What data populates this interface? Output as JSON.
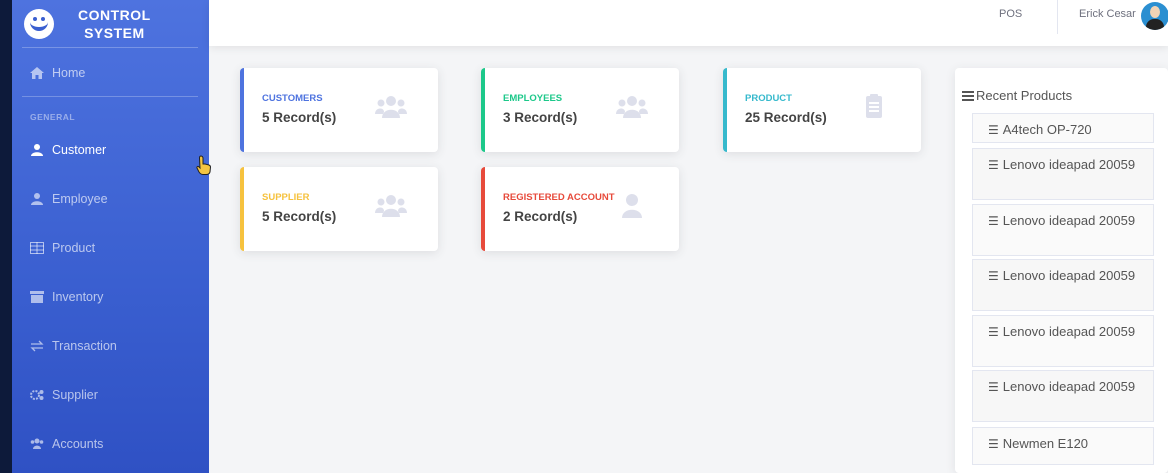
{
  "brand": {
    "line1": "CONTROL",
    "line2": "SYSTEM",
    "logo_icon": "smiley-logo-icon"
  },
  "sidebar": {
    "home": "Home",
    "heading": "GENERAL",
    "items": [
      {
        "label": "Customer",
        "icon": "user-icon",
        "active": true
      },
      {
        "label": "Employee",
        "icon": "user-icon",
        "active": false
      },
      {
        "label": "Product",
        "icon": "table-icon",
        "active": false
      },
      {
        "label": "Inventory",
        "icon": "archive-icon",
        "active": false
      },
      {
        "label": "Transaction",
        "icon": "exchange-icon",
        "active": false
      },
      {
        "label": "Supplier",
        "icon": "cogs-icon",
        "active": false
      },
      {
        "label": "Accounts",
        "icon": "users-icon",
        "active": false
      }
    ]
  },
  "topbar": {
    "pos": "POS",
    "user_name": "Erick Cesar"
  },
  "cards": [
    {
      "label": "CUSTOMERS",
      "value": "5 Record(s)",
      "color": "#4e73df",
      "icon": "users-group-icon"
    },
    {
      "label": "EMPLOYEES",
      "value": "3 Record(s)",
      "color": "#1cc88a",
      "icon": "users-group-icon"
    },
    {
      "label": "PRODUCT",
      "value": "25 Record(s)",
      "color": "#36b9cc",
      "icon": "clipboard-icon"
    },
    {
      "label": "SUPPLIER",
      "value": "5 Record(s)",
      "color": "#f6c23e",
      "icon": "users-group-icon"
    },
    {
      "label": "REGISTERED ACCOUNT",
      "value": "2 Record(s)",
      "color": "#e74a3b",
      "icon": "user-icon"
    }
  ],
  "recent_products": {
    "title": "Recent Products",
    "items": [
      "A4tech OP-720",
      "Lenovo ideapad 20059",
      "Lenovo ideapad 20059",
      "Lenovo ideapad 20059",
      "Lenovo ideapad 20059",
      "Lenovo ideapad 20059",
      "Newmen E120"
    ]
  }
}
